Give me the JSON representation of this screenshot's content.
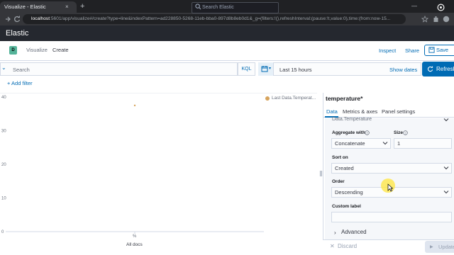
{
  "browser": {
    "tab_title": "Visualize - Elastic",
    "tab_close": "×",
    "new_tab": "+",
    "win_min": "—",
    "url_host": "localhost",
    "url_rest": ":5601/app/visualize#/create?type=line&indexPattern=ad228850-5268-11eb-bba0-897d8b8eb0d1&_g=(filters:!(),refreshInterval:(pause:!t,value:0),time:(from:now-15..."
  },
  "kibana_header": {
    "title": "Elastic",
    "search_placeholder": "Search Elastic"
  },
  "breadcrumbs": {
    "space_badge": "D",
    "items": [
      "Visualize",
      "Create"
    ]
  },
  "top_actions": {
    "inspect": "Inspect",
    "share": "Share",
    "save": "Save"
  },
  "query_bar": {
    "placeholder": "Search",
    "language": "KQL",
    "date_range": "Last 15 hours",
    "show_dates": "Show dates",
    "refresh": "Refresh"
  },
  "filters": {
    "add_filter": "+ Add filter"
  },
  "chart_data": {
    "type": "line",
    "categories": [
      "All docs"
    ],
    "series": [
      {
        "name": "Last Data.Temperat...",
        "color": "#d6a35c",
        "values": [
          37.5
        ]
      }
    ],
    "yticks": [
      "40",
      "30",
      "20",
      "10",
      "0"
    ],
    "ylim": [
      0,
      40
    ],
    "xlabel": "All docs",
    "xtick": "%",
    "grid": false,
    "legend": "top-right"
  },
  "panel": {
    "title": "temperature*",
    "tabs": [
      "Data",
      "Metrics & axes",
      "Panel settings"
    ],
    "field_name": "Data.Temperature",
    "aggregate_label": "Aggregate with",
    "aggregate_value": "Concatenate",
    "size_label": "Size",
    "size_value": "1",
    "sort_label": "Sort on",
    "sort_value": "Created",
    "order_label": "Order",
    "order_value": "Descending",
    "custom_label": "Custom label",
    "custom_value": "",
    "advanced": "Advanced",
    "discard": "Discard",
    "update": "Update"
  }
}
